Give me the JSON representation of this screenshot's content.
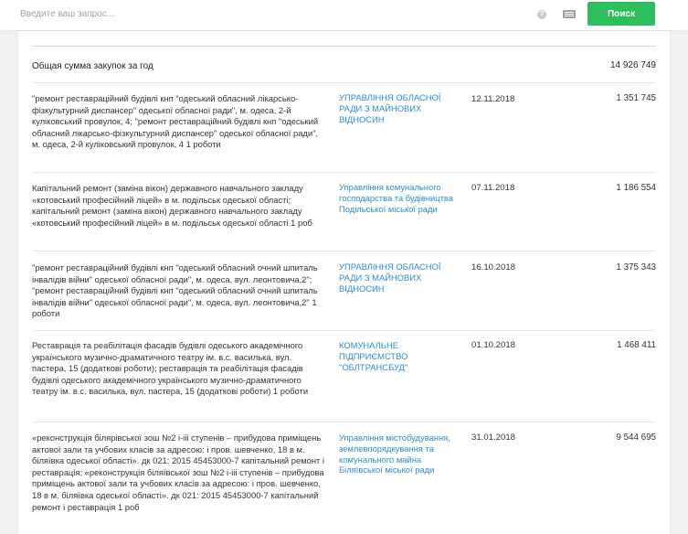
{
  "search": {
    "placeholder": "Введите ваш запрос...",
    "help_glyph": "?",
    "button_label": "Поиск"
  },
  "summary": {
    "label": "Общая сумма закупок за год",
    "total": "14 926 749"
  },
  "rows": [
    {
      "description": "\"ремонт реставраційний будівлі кнп \"одеський обласний лікарсько-фізкультурний диспансер\" одеської обласної ради\", м. одеса, 2-й куліковський провулок, 4; \"ремонт реставраційний будівлі кнп \"одеський обласний лікарсько-фізкультурний диспансер\" одеської обласної ради\", м. одеса, 2-й куліковський провулок, 4 1 роботи",
      "organization": "УПРАВЛІННЯ ОБЛАСНОЇ РАДИ З МАЙНОВИХ ВІДНОСИН",
      "date": "12.11.2018",
      "amount": "1 351 745"
    },
    {
      "description": "Капітальний ремонт (заміна вікон) державного навчального закладу «котовський професійний ліцей» в м. подільськ одеської області; капітальний ремонт (заміна вікон) державного навчального закладу «котовський професійний ліцей» в м. подільськ одеської області 1 роб",
      "organization": "Управління комунального господарства та будівництва Подільської міської ради",
      "date": "07.11.2018",
      "amount": "1 186 554"
    },
    {
      "description": "\"ремонт реставраційний будівлі кнп \"одеський обласний очний шпиталь інвалідів війни\" одеської обласної ради\", м. одеса, вул. леонтовича,2\"; \"ремонт реставраційний будівлі кнп \"одеський обласний очний шпиталь інвалідів війни\" одеської обласної ради\", м. одеса, вул. леонтовича,2\" 1 роботи",
      "organization": "УПРАВЛІННЯ ОБЛАСНОЇ РАДИ З МАЙНОВИХ ВІДНОСИН",
      "date": "16.10.2018",
      "amount": "1 375 343"
    },
    {
      "description": "Реставрація та реабілітація фасадів будівлі одеського академічного українського музично-драматичного театру ім. в.с. василька, вул. пастера, 15 (додаткові роботи); реставрація та реабілітація фасадів будівлі одеського академічного українського музично-драматичного театру ім. в.с. василька, вул. пастера, 15 (додаткові роботи) 1 роботи",
      "organization": "КОМУНАЛЬНЕ ПІДПРИЄМСТВО \"ОБЛТРАНСБУД\"",
      "date": "01.10.2018",
      "amount": "1 468 411"
    },
    {
      "description": "«реконструкція білярівської зош №2 і-ііі ступенів – прибудова приміщень актової зали та учбових класів за адресою: і пров. шевченко, 18 в м. біляївка одеської області». дк 021: 2015 45453000-7 капітальний ремонт і реставрація; «реконструкція біляївської зош №2 і-ііі ступенів – прибудова приміщень актової зали та учбових класів за адресою: і пров. шевченко, 18 в м. біляївка одеської області». дк 021: 2015 45453000-7 капітальний ремонт і реставрація 1 роб",
      "organization": "Управління містобудування, землевпорядкування та комунального майна Біляївської міської ради",
      "date": "31.01.2018",
      "amount": "9 544 695"
    }
  ]
}
